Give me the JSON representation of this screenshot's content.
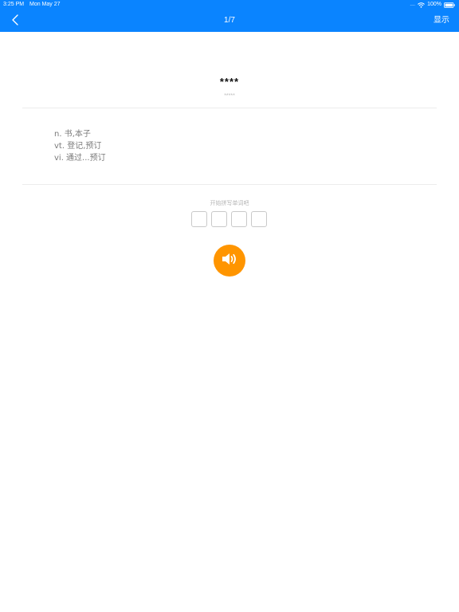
{
  "status_bar": {
    "time": "3:25 PM",
    "date": "Mon May 27",
    "signal_dots": "....",
    "battery_percent": "100%",
    "icons": [
      "wifi-icon",
      "battery-icon"
    ]
  },
  "nav": {
    "back_icon": "chevron-left-icon",
    "title": "1/7",
    "show_label": "显示"
  },
  "word": {
    "masked": "****",
    "phonetic_masked": "*****"
  },
  "definitions": [
    "n. 书,本子",
    "vt. 登记,预订",
    "vi. 通过...预订"
  ],
  "spelling": {
    "hint": "开始拼写单词吧",
    "letter_count": 4
  },
  "speaker": {
    "icon": "speaker-icon"
  },
  "colors": {
    "nav_background": "#0a84ff",
    "speaker_button": "#ff9500",
    "definition_text": "#7a7a7a",
    "divider": "#ececec"
  }
}
